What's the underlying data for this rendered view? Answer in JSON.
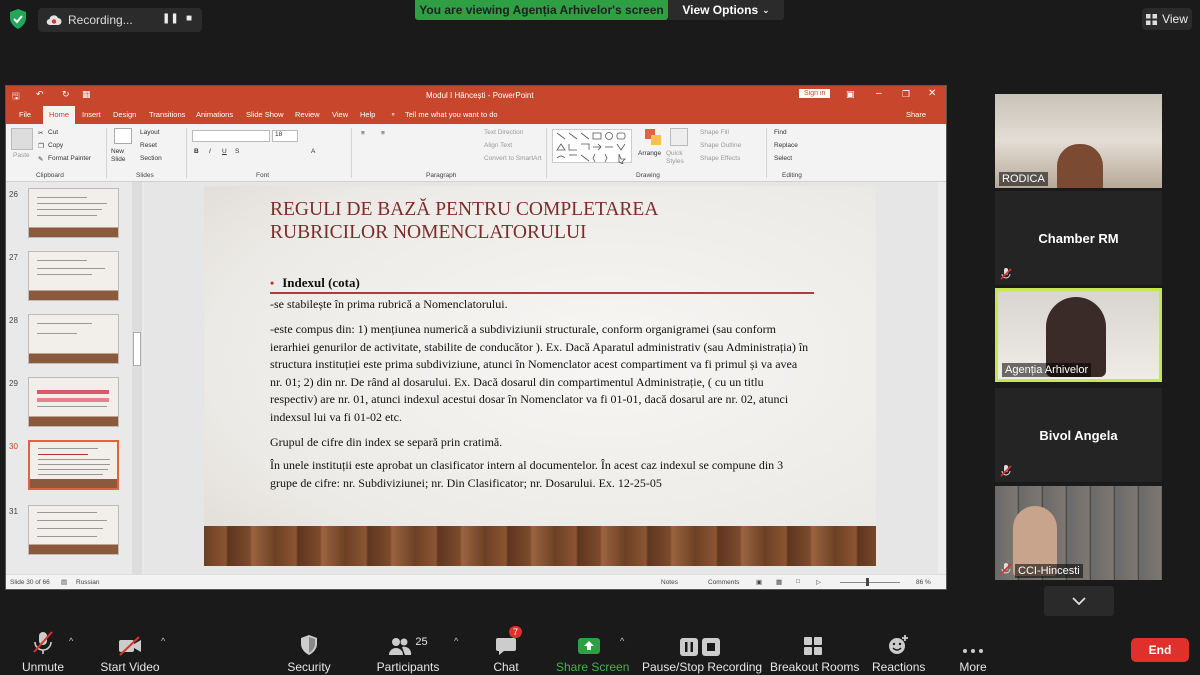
{
  "zoom": {
    "recording_label": "Recording...",
    "banner": "You are viewing Agenția Arhivelor's screen",
    "view_options": "View Options",
    "view": "View"
  },
  "ppt": {
    "window_title": "Modul I Hâncești  -  PowerPoint",
    "sign_in": "Sign in",
    "tabs": [
      "File",
      "Home",
      "Insert",
      "Design",
      "Transitions",
      "Animations",
      "Slide Show",
      "Review",
      "View",
      "Help"
    ],
    "tell_me": "Tell me what you want to do",
    "share": "Share",
    "ribbon": {
      "paste": "Paste",
      "cut": "Cut",
      "copy": "Copy",
      "format_painter": "Format Painter",
      "clipboard": "Clipboard",
      "new_slide": "New Slide",
      "layout": "Layout",
      "reset": "Reset",
      "section": "Section",
      "slides": "Slides",
      "font_size": "18",
      "font": "Font",
      "text_direction": "Text Direction",
      "align_text": "Align Text",
      "convert_smartart": "Convert to SmartArt",
      "paragraph": "Paragraph",
      "arrange": "Arrange",
      "quick_styles": "Quick Styles",
      "shape_fill": "Shape Fill",
      "shape_outline": "Shape Outline",
      "shape_effects": "Shape Effects",
      "drawing": "Drawing",
      "find": "Find",
      "replace": "Replace",
      "select": "Select",
      "editing": "Editing"
    },
    "thumbnails": [
      {
        "num": "26"
      },
      {
        "num": "27"
      },
      {
        "num": "28"
      },
      {
        "num": "29"
      },
      {
        "num": "30"
      },
      {
        "num": "31"
      }
    ],
    "slide": {
      "title_line1": "REGULI DE BAZĂ PENTRU COMPLETAREA",
      "title_line2": "RUBRICILOR NOMENCLATORULUI",
      "bullet": "Indexul (cota)",
      "p1": "-se stabilește în prima rubrică a Nomenclatorului.",
      "p2": "-este compus din: 1) mențiunea numerică a subdiviziunii structurale, conform organigramei (sau conform ierarhiei genurilor de activitate, stabilite de conducător ). Ex. Dacă Aparatul administrativ (sau Administrația) în structura instituției este prima subdiviziune, atunci în Nomenclator acest compartiment va fi primul și va avea  nr. 01; 2) din nr. De rând al dosarului. Ex. Dacă dosarul din compartimentul Administrație, ( cu un titlu respectiv) are nr. 01, atunci indexul acestui dosar în Nomenclator va fi 01-01, dacă dosarul are nr. 02, atunci indexsul lui va fi 01-02 etc.",
      "p3": "Grupul de cifre din index se separă prin cratimă.",
      "p4": "În unele instituții este aprobat un clasificator intern al documentelor. În acest caz indexul se compune din 3 grupe de cifre: nr. Subdiviziunei; nr. Din Clasificator; nr. Dosarului. Ex. 12-25-05"
    },
    "status": {
      "slide_of": "Slide 30 of 66",
      "language": "Russian",
      "notes": "Notes",
      "comments": "Comments",
      "zoom": "86 %"
    }
  },
  "participants": [
    {
      "name": "RODICA",
      "video": true
    },
    {
      "name": "Chamber RM",
      "video": false
    },
    {
      "name": "Agenția Arhivelor",
      "video": true,
      "active": true
    },
    {
      "name": "Bivol Angela",
      "video": false
    },
    {
      "name": "CCI-Hincesti",
      "video": true
    }
  ],
  "toolbar": {
    "unmute": "Unmute",
    "start_video": "Start Video",
    "security": "Security",
    "participants": "Participants",
    "participants_count": "25",
    "chat": "Chat",
    "chat_badge": "7",
    "share_screen": "Share Screen",
    "pause_recording": "Pause/Stop Recording",
    "breakout_rooms": "Breakout Rooms",
    "reactions": "Reactions",
    "more": "More",
    "end": "End"
  },
  "colors": {
    "ppt_accent": "#c8462b",
    "banner_green": "#2ea043",
    "share_green": "#4caf50",
    "end_red": "#e0302b",
    "active_border": "#c6e84c",
    "slide_title": "#7a2e2a"
  }
}
